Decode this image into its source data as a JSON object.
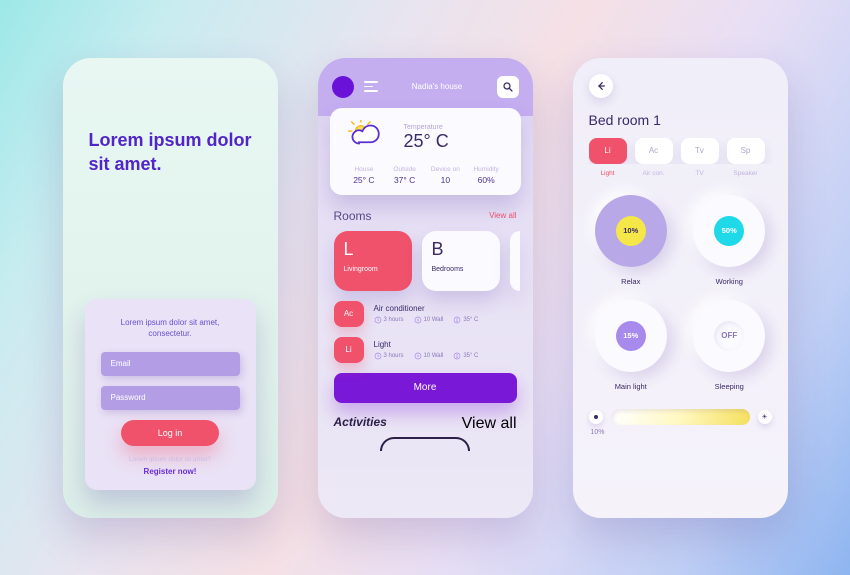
{
  "screen1": {
    "headline": "Lorem ipsum dolor sit amet.",
    "card_sub": "Lorem ipsum dolor sit amet, consectetur.",
    "email_ph": "Email",
    "password_ph": "Password",
    "login_btn": "Log in",
    "tiny": "Lorem ipsum dolor sit amet?",
    "register": "Register now!"
  },
  "screen2": {
    "top_title": "Nadia's house",
    "weather": {
      "temp_label": "Temperature",
      "temp": "25° C",
      "cells": [
        {
          "l": "House",
          "v": "25° C"
        },
        {
          "l": "Outside",
          "v": "37° C"
        },
        {
          "l": "Device on",
          "v": "10"
        },
        {
          "l": "Humidity",
          "v": "60%"
        }
      ]
    },
    "rooms_title": "Rooms",
    "rooms_link": "View all",
    "rooms": [
      {
        "letter": "L",
        "name": "Livingroom",
        "active": true
      },
      {
        "letter": "B",
        "name": "Bedrooms",
        "active": false
      }
    ],
    "devices": [
      {
        "code": "Ac",
        "name": "Air conditioner",
        "stats": [
          "3 hours",
          "10 Wall",
          "35° C"
        ]
      },
      {
        "code": "Li",
        "name": "Light",
        "stats": [
          "3 hours",
          "10 Wall",
          "35° C"
        ]
      }
    ],
    "more": "More",
    "activities_title": "Activities",
    "activities_link": "View all"
  },
  "screen3": {
    "room": "Bed room 1",
    "tabs": [
      {
        "code": "Li",
        "label": "Light",
        "active": true
      },
      {
        "code": "Ac",
        "label": "Air con."
      },
      {
        "code": "Tv",
        "label": "TV"
      },
      {
        "code": "Sp",
        "label": "Speaker"
      }
    ],
    "dials": [
      {
        "val": "10%",
        "label": "Relax"
      },
      {
        "val": "50%",
        "label": "Working"
      },
      {
        "val": "15%",
        "label": "Main light"
      },
      {
        "val": "OFF",
        "label": "Sleeping"
      }
    ],
    "slider_val": "10%"
  }
}
